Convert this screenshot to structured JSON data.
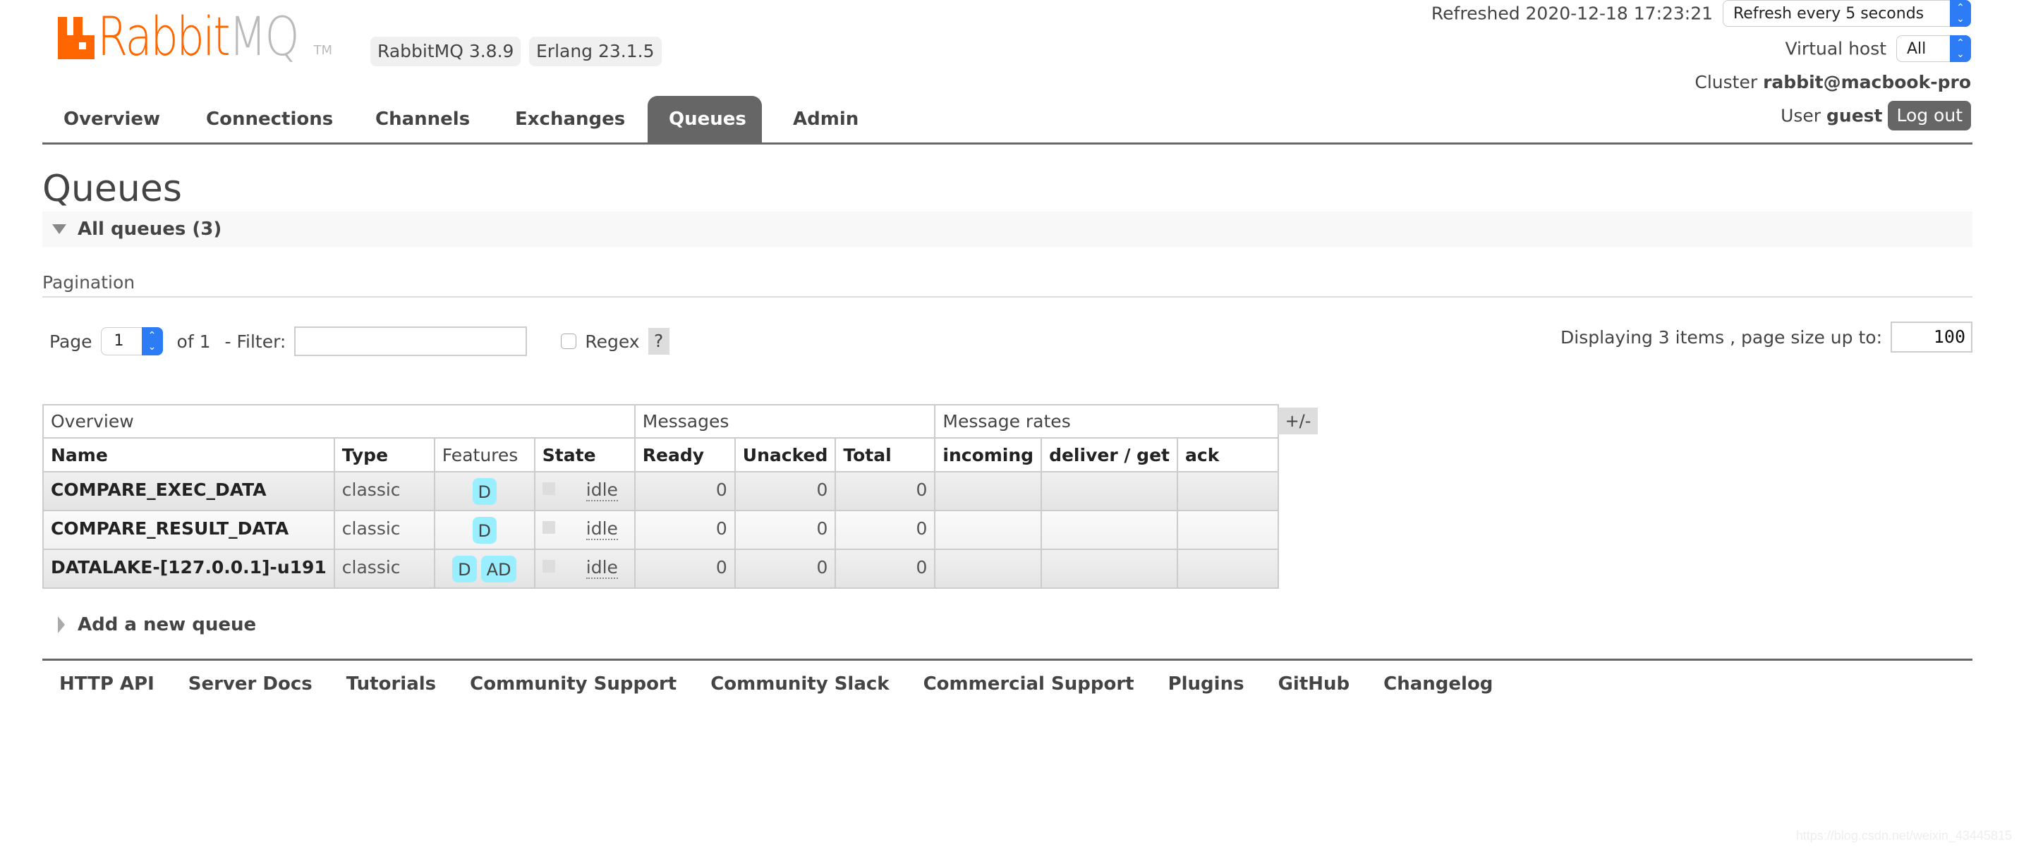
{
  "header": {
    "logo_text_primary": "Rabbit",
    "logo_text_secondary": "MQ",
    "logo_tm": "TM",
    "version_badge": "RabbitMQ 3.8.9",
    "erlang_badge": "Erlang 23.1.5",
    "refreshed_label": "Refreshed 2020-12-18 17:23:21",
    "refresh_select": "Refresh every 5 seconds",
    "virtual_host_label": "Virtual host",
    "virtual_host_select": "All",
    "cluster_label": "Cluster",
    "cluster_value": "rabbit@macbook-pro",
    "user_label": "User",
    "user_value": "guest",
    "logout_label": "Log out"
  },
  "nav": {
    "tabs": [
      {
        "label": "Overview",
        "active": false
      },
      {
        "label": "Connections",
        "active": false
      },
      {
        "label": "Channels",
        "active": false
      },
      {
        "label": "Exchanges",
        "active": false
      },
      {
        "label": "Queues",
        "active": true
      },
      {
        "label": "Admin",
        "active": false
      }
    ]
  },
  "page": {
    "title": "Queues",
    "section_title": "All queues (3)",
    "pagination_label": "Pagination",
    "page_label": "Page",
    "page_value": "1",
    "of_label": "of 1",
    "filter_label": "- Filter:",
    "filter_value": "",
    "regex_label": "Regex",
    "regex_checked": false,
    "help_label": "?",
    "displaying_label": "Displaying 3 items , page size up to:",
    "page_size_value": "100",
    "toggle_columns_label": "+/-",
    "add_queue_label": "Add a new queue"
  },
  "table": {
    "groups": [
      "Overview",
      "Messages",
      "Message rates"
    ],
    "columns": [
      "Name",
      "Type",
      "Features",
      "State",
      "Ready",
      "Unacked",
      "Total",
      "incoming",
      "deliver / get",
      "ack"
    ],
    "rows": [
      {
        "name": "COMPARE_EXEC_DATA",
        "type": "classic",
        "features": [
          "D"
        ],
        "state": "idle",
        "ready": "0",
        "unacked": "0",
        "total": "0",
        "incoming": "",
        "deliver_get": "",
        "ack": ""
      },
      {
        "name": "COMPARE_RESULT_DATA",
        "type": "classic",
        "features": [
          "D"
        ],
        "state": "idle",
        "ready": "0",
        "unacked": "0",
        "total": "0",
        "incoming": "",
        "deliver_get": "",
        "ack": ""
      },
      {
        "name": "DATALAKE-[127.0.0.1]-u191",
        "type": "classic",
        "features": [
          "D",
          "AD"
        ],
        "state": "idle",
        "ready": "0",
        "unacked": "0",
        "total": "0",
        "incoming": "",
        "deliver_get": "",
        "ack": ""
      }
    ]
  },
  "footer": {
    "links": [
      "HTTP API",
      "Server Docs",
      "Tutorials",
      "Community Support",
      "Community Slack",
      "Commercial Support",
      "Plugins",
      "GitHub",
      "Changelog"
    ]
  },
  "watermark": "https://blog.csdn.net/weixin_43445815",
  "colors": {
    "brand_orange": "#ff6600",
    "nav_active": "#666666",
    "feature_badge": "#99eeff",
    "select_accent": "#2d7cf6"
  }
}
